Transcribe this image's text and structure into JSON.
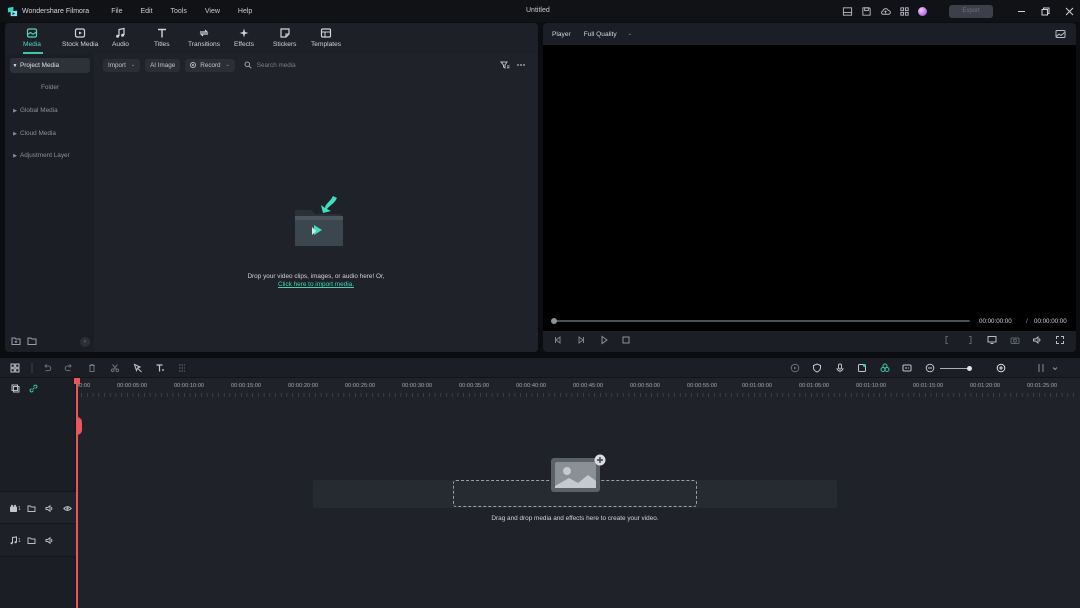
{
  "app": {
    "name": "Wondershare Filmora",
    "document_title": "Untitled",
    "menu": [
      "File",
      "Edit",
      "Tools",
      "View",
      "Help"
    ],
    "export_label": "Export",
    "accent": "#35c9b0"
  },
  "media_tabs": [
    {
      "label": "Media",
      "icon": "media-icon",
      "active": true
    },
    {
      "label": "Stock Media",
      "icon": "stock-media-icon"
    },
    {
      "label": "Audio",
      "icon": "music-note-icon"
    },
    {
      "label": "Titles",
      "icon": "text-t-icon"
    },
    {
      "label": "Transitions",
      "icon": "transition-icon"
    },
    {
      "label": "Effects",
      "icon": "effects-sparkle-icon"
    },
    {
      "label": "Stickers",
      "icon": "sticker-icon"
    },
    {
      "label": "Templates",
      "icon": "template-icon"
    }
  ],
  "sidebar": {
    "project_media": "Project Media",
    "folder": "Folder",
    "global_media": "Global Media",
    "cloud_media": "Cloud Media",
    "adjustment_layer": "Adjustment Layer"
  },
  "media_toolbar": {
    "import": "Import",
    "ai_image": "AI Image",
    "record": "Record",
    "search_placeholder": "Search media"
  },
  "drop_area": {
    "text": "Drop your video clips, images, or audio here! Or,",
    "link": "Click here to import media."
  },
  "player": {
    "label": "Player",
    "quality": "Full Quality",
    "current_time": "00:00:00:00",
    "separator": "/",
    "total_time": "00:00:00:00",
    "progress": 0
  },
  "timeline": {
    "ruler_labels": [
      "00:00",
      "00:00:05:00",
      "00:00:10:00",
      "00:00:15:00",
      "00:00:20:00",
      "00:00:25:00",
      "00:00:30:00",
      "00:00:35:00",
      "00:00:40:00",
      "00:00:45:00",
      "00:00:50:00",
      "00:00:55:00",
      "00:01:00:00",
      "00:01:05:00",
      "00:01:10:00",
      "00:01:15:00",
      "00:01:20:00",
      "00:01:25:00"
    ],
    "video_track_num": "1",
    "audio_track_num": "1",
    "hint": "Drag and drop media and effects here to create your video."
  }
}
